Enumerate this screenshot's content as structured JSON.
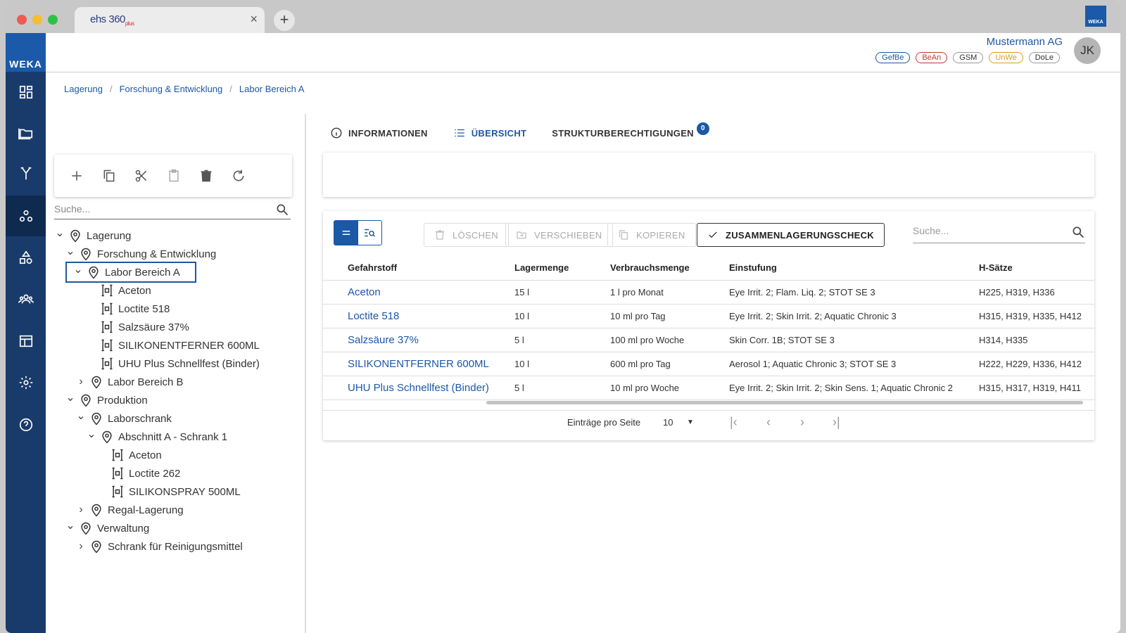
{
  "browser": {
    "tab_title": "ehs 360",
    "tab_title_suffix": "plus",
    "tab_close": "×",
    "new_tab": "+",
    "corner_logo": "WEKA"
  },
  "sidebar": {
    "brand": "WEKA",
    "items": [
      {
        "icon": "dashboard-icon"
      },
      {
        "icon": "folder-icon"
      },
      {
        "icon": "branch-icon"
      },
      {
        "icon": "hierarchy-icon",
        "active": true
      },
      {
        "icon": "shapes-icon"
      },
      {
        "icon": "users-icon"
      },
      {
        "icon": "table-icon"
      },
      {
        "icon": "gear-icon"
      },
      {
        "icon": "help-icon"
      }
    ]
  },
  "header": {
    "company": "Mustermann AG",
    "modules": [
      {
        "label": "GefBe",
        "color": "#1b58a5"
      },
      {
        "label": "BeAn",
        "color": "#c0392b"
      },
      {
        "label": "GSM",
        "color": "#333333"
      },
      {
        "label": "UnWe",
        "color": "#d4a017"
      },
      {
        "label": "DoLe",
        "color": "#333333"
      }
    ],
    "avatar": "JK"
  },
  "breadcrumb": [
    "Lagerung",
    "Forschung & Entwicklung",
    "Labor Bereich A"
  ],
  "breadcrumb_sep": "/",
  "tree": {
    "search_placeholder": "Suche...",
    "nodes": [
      {
        "label": "Lagerung",
        "depth": 0,
        "type": "location",
        "expand": "open"
      },
      {
        "label": "Forschung & Entwicklung",
        "depth": 1,
        "type": "location",
        "expand": "open"
      },
      {
        "label": "Labor Bereich A",
        "depth": 2,
        "type": "location",
        "expand": "open",
        "selected": true
      },
      {
        "label": "Aceton",
        "depth": 3,
        "type": "substance"
      },
      {
        "label": "Loctite 518",
        "depth": 3,
        "type": "substance"
      },
      {
        "label": "Salzsäure 37%",
        "depth": 3,
        "type": "substance"
      },
      {
        "label": "SILIKONENTFERNER 600ML",
        "depth": 3,
        "type": "substance"
      },
      {
        "label": "UHU Plus Schnellfest (Binder)",
        "depth": 3,
        "type": "substance"
      },
      {
        "label": "Labor Bereich B",
        "depth": 2,
        "type": "location",
        "expand": "closed"
      },
      {
        "label": "Produktion",
        "depth": 1,
        "type": "location",
        "expand": "open"
      },
      {
        "label": "Laborschrank",
        "depth": 2,
        "type": "location",
        "expand": "open"
      },
      {
        "label": "Abschnitt A - Schrank 1",
        "depth": 3,
        "type": "location",
        "expand": "open"
      },
      {
        "label": "Aceton",
        "depth": 4,
        "type": "substance"
      },
      {
        "label": "Loctite 262",
        "depth": 4,
        "type": "substance"
      },
      {
        "label": "SILIKONSPRAY 500ML",
        "depth": 4,
        "type": "substance"
      },
      {
        "label": "Regal-Lagerung",
        "depth": 2,
        "type": "location",
        "expand": "closed"
      },
      {
        "label": "Verwaltung",
        "depth": 1,
        "type": "location",
        "expand": "open"
      },
      {
        "label": "Schrank für Reinigungsmittel",
        "depth": 2,
        "type": "location",
        "expand": "closed"
      }
    ]
  },
  "tabs": [
    {
      "label": "INFORMATIONEN",
      "icon": "info-icon"
    },
    {
      "label": "ÜBERSICHT",
      "icon": "list-icon",
      "active": true
    },
    {
      "label": "STRUKTURBERECHTIGUNGEN",
      "badge": "0"
    }
  ],
  "actions": {
    "delete": "LÖSCHEN",
    "move": "VERSCHIEBEN",
    "copy": "KOPIEREN",
    "check": "ZUSAMMENLAGERUNGSCHECK",
    "search_placeholder": "Suche..."
  },
  "table": {
    "columns": [
      "Gefahrstoff",
      "Lagermenge",
      "Verbrauchsmenge",
      "Einstufung",
      "H-Sätze"
    ],
    "rows": [
      [
        "Aceton",
        "15 l",
        "1 l pro Monat",
        "Eye Irrit. 2; Flam. Liq. 2; STOT SE 3",
        "H225, H319, H336"
      ],
      [
        "Loctite 518",
        "10 l",
        "10 ml pro Tag",
        "Eye Irrit. 2; Skin Irrit. 2; Aquatic Chronic 3",
        "H315, H319, H335, H412"
      ],
      [
        "Salzsäure 37%",
        "5 l",
        "100 ml pro Woche",
        "Skin Corr. 1B; STOT SE 3",
        "H314, H335"
      ],
      [
        "SILIKONENTFERNER 600ML",
        "10 l",
        "600 ml pro Tag",
        "Aerosol 1; Aquatic Chronic 3; STOT SE 3",
        "H222, H229, H336, H412"
      ],
      [
        "UHU Plus Schnellfest (Binder)",
        "5 l",
        "10 ml pro Woche",
        "Eye Irrit. 2; Skin Irrit. 2; Skin Sens. 1; Aquatic Chronic 2",
        "H315, H317, H319, H411"
      ]
    ]
  },
  "pager": {
    "label": "Einträge pro Seite",
    "per_page": "10",
    "first": "|‹",
    "prev": "‹",
    "next": "›",
    "last": "›|"
  },
  "colors": {
    "sidebar": "#193b6b",
    "accent": "#1b58a5"
  }
}
